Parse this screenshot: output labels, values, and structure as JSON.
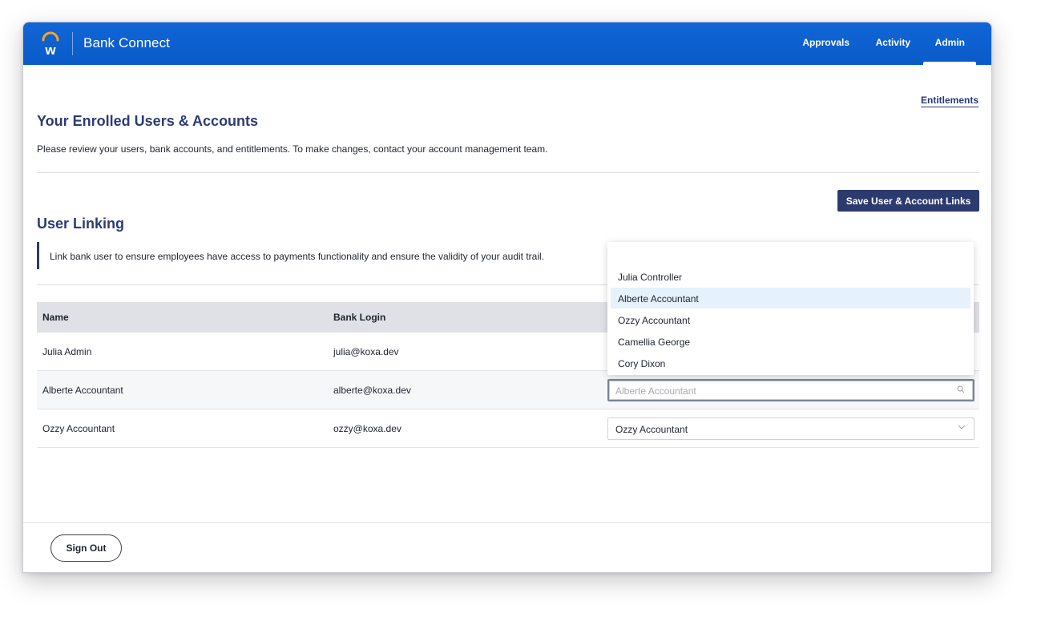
{
  "header": {
    "app_title": "Bank Connect",
    "nav": [
      {
        "label": "Approvals"
      },
      {
        "label": "Activity"
      },
      {
        "label": "Admin",
        "active": true
      }
    ],
    "brand_color": "#0b5fcf"
  },
  "entitlements_link": "Entitlements",
  "enrolled": {
    "title": "Your Enrolled Users & Accounts",
    "description": "Please review your users, bank accounts, and entitlements. To make changes, contact your account management team."
  },
  "linking": {
    "save_label": "Save User & Account Links",
    "title": "User Linking",
    "callout": "Link bank user to ensure employees have access to payments functionality and ensure the validity of your audit trail."
  },
  "table": {
    "columns": [
      "Name",
      "Bank Login",
      ""
    ],
    "rows": [
      {
        "name": "Julia Admin",
        "login": "julia@koxa.dev",
        "linked": ""
      },
      {
        "name": "Alberte Accountant",
        "login": "alberte@koxa.dev",
        "linked": "",
        "placeholder": "Alberte Accountant"
      },
      {
        "name": "Ozzy Accountant",
        "login": "ozzy@koxa.dev",
        "linked": "Ozzy Accountant"
      }
    ]
  },
  "dropdown": {
    "options": [
      "Julia Controller",
      "Alberte Accountant",
      "Ozzy Accountant",
      "Camellia George",
      "Cory Dixon"
    ],
    "highlighted": "Alberte Accountant"
  },
  "footer": {
    "sign_out": "Sign Out"
  },
  "icons": {
    "logo": "workday-logo-icon",
    "chevron": "chevron-down-icon",
    "search": "search-icon"
  }
}
